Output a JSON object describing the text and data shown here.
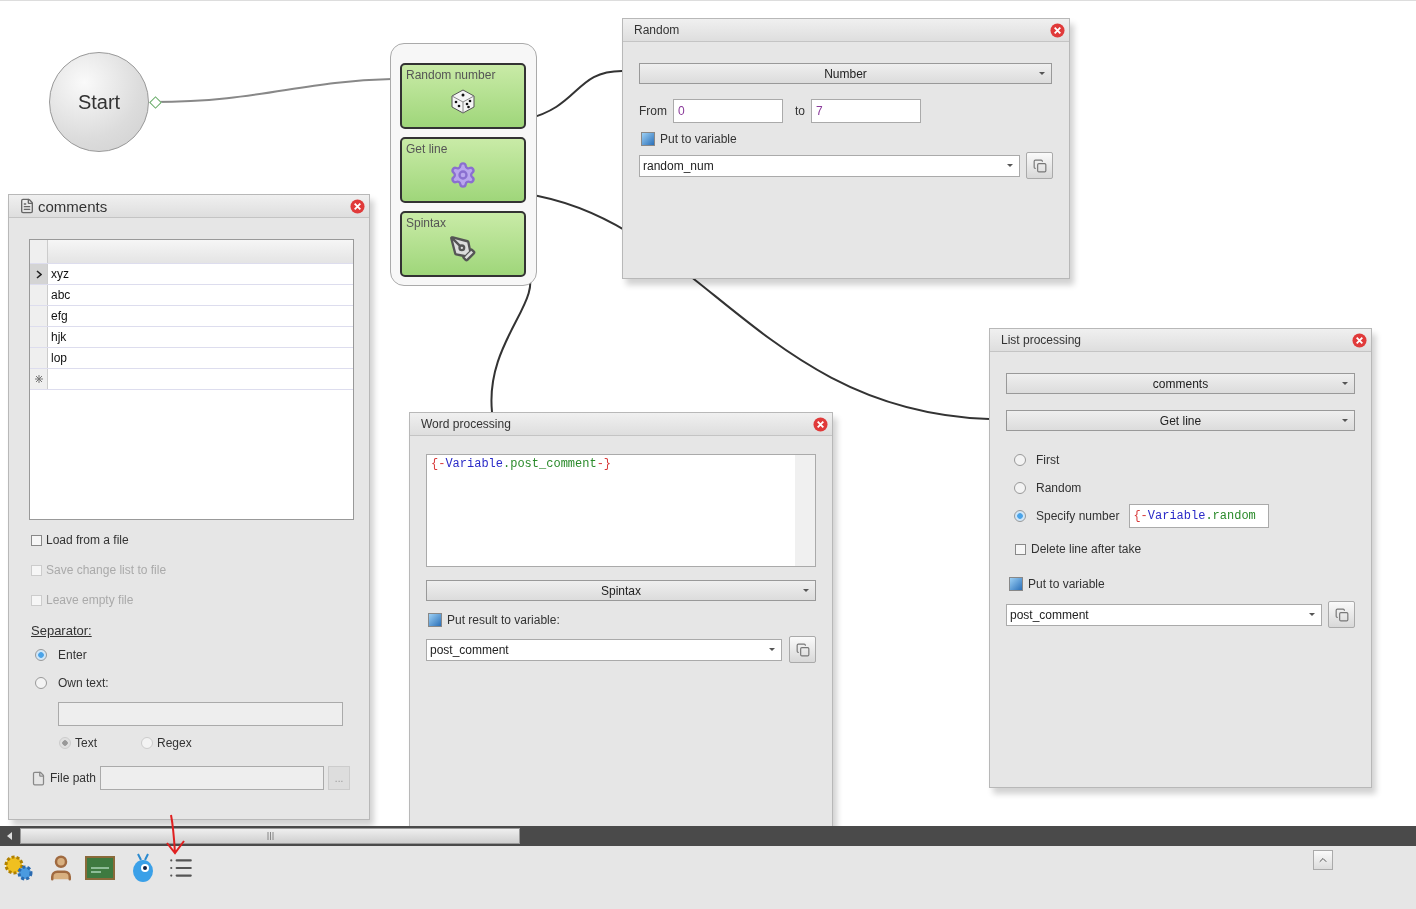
{
  "start_node": {
    "label": "Start"
  },
  "action_nodes": [
    {
      "label": "Random number",
      "kind": "dice"
    },
    {
      "label": "Get line",
      "kind": "gear"
    },
    {
      "label": "Spintax",
      "kind": "pen"
    }
  ],
  "comments_panel": {
    "title": "comments",
    "rows": [
      {
        "text": "xyz",
        "selected": true
      },
      {
        "text": "abc",
        "selected": false
      },
      {
        "text": "efg",
        "selected": false
      },
      {
        "text": "hjk",
        "selected": false
      },
      {
        "text": "lop",
        "selected": false
      }
    ],
    "options": [
      {
        "label": "Load from a file",
        "checked": false,
        "disabled": false
      },
      {
        "label": "Save change list to file",
        "checked": false,
        "disabled": true
      },
      {
        "label": "Leave empty file",
        "checked": false,
        "disabled": true
      }
    ],
    "separator_label": "Separator:",
    "separator_options": [
      {
        "label": "Enter",
        "selected": true
      },
      {
        "label": "Own text:",
        "selected": false
      }
    ],
    "match_modes": [
      {
        "label": "Text",
        "selected": true,
        "disabled": true
      },
      {
        "label": "Regex",
        "selected": false,
        "disabled": true
      }
    ],
    "file_path_label": "File path",
    "browse_button": "..."
  },
  "random_panel": {
    "title": "Random",
    "type_select": "Number",
    "from_label": "From",
    "from_value": "0",
    "to_label": "to",
    "to_value": "7",
    "put_to_variable": {
      "label": "Put to variable",
      "checked": true
    },
    "variable": "random_num"
  },
  "word_panel": {
    "title": "Word processing",
    "script_tokens": [
      {
        "text": "{-",
        "color": "#d83a3a"
      },
      {
        "text": "Variable",
        "color": "#2a2ac8"
      },
      {
        "text": ".post_comment",
        "color": "#2a8a2a"
      },
      {
        "text": "-}",
        "color": "#d83a3a"
      }
    ],
    "mode_select": "Spintax",
    "put_to_variable": {
      "label": "Put result to variable:",
      "checked": true
    },
    "variable": "post_comment"
  },
  "list_panel": {
    "title": "List processing",
    "list_select": "comments",
    "action_select": "Get line",
    "line_options": [
      {
        "label": "First",
        "selected": false
      },
      {
        "label": "Random",
        "selected": false
      },
      {
        "label": "Specify number",
        "selected": true
      }
    ],
    "number_tokens": [
      {
        "text": "{-",
        "color": "#d83a3a"
      },
      {
        "text": "Variable",
        "color": "#2a2ac8"
      },
      {
        "text": ".random",
        "color": "#2a8a2a"
      }
    ],
    "delete_after_take": {
      "label": "Delete line after take",
      "checked": false
    },
    "put_to_variable": {
      "label": "Put to variable",
      "checked": true
    },
    "variable": "post_comment"
  }
}
